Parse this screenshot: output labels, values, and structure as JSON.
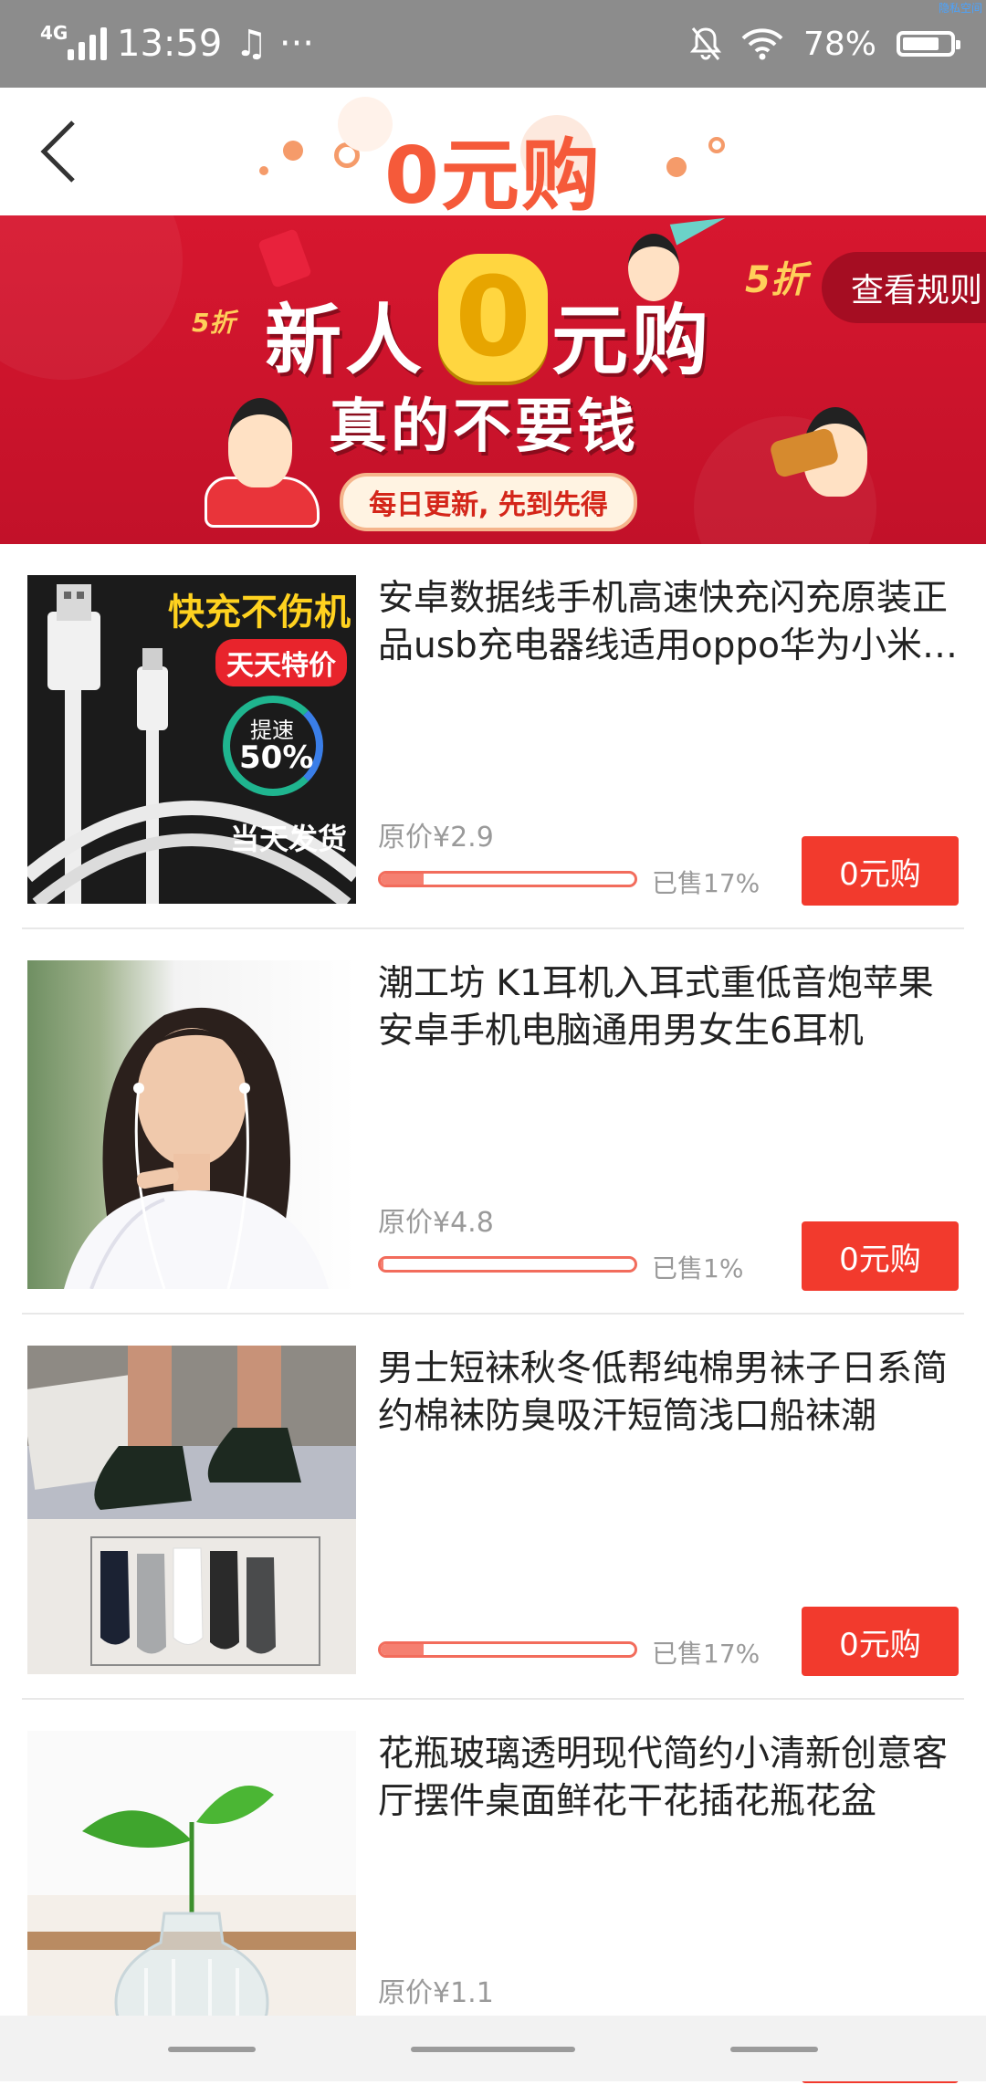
{
  "status_bar": {
    "network": "4G",
    "time": "13:59",
    "extra_icons": "♫ ···",
    "battery_text": "78%",
    "battery_level": 0.78,
    "corner_note": "隐私空间"
  },
  "header": {
    "title": "0元购",
    "back_icon": "chevron-left-icon"
  },
  "banner": {
    "headline_left": "新人",
    "headline_zero": "0",
    "headline_right": "元购",
    "subline": "真的不要钱",
    "pill_text": "每日更新, 先到先得",
    "rules_button": "查看规则",
    "tag_left": "5折",
    "tag_right": "5折",
    "accent": "#d7172f"
  },
  "products": [
    {
      "name": "安卓数据线手机高速快充闪充原装正品usb充电器线适用oppo华为小米vivo",
      "original_price": "原价¥2.9",
      "sold": "已售17%",
      "sold_fraction": 0.17,
      "buy_label": "0元购",
      "thumb": {
        "type": "cable",
        "headline": "快充不伤机",
        "badge": "天天特价",
        "speed_label": "提速",
        "speed_value": "50%",
        "ship": "当天发货"
      }
    },
    {
      "name": "潮工坊 K1耳机入耳式重低音炮苹果安卓手机电脑通用男女生6耳机",
      "original_price": "原价¥4.8",
      "sold": "已售1%",
      "sold_fraction": 0.01,
      "buy_label": "0元购",
      "thumb": {
        "type": "earphone-model"
      }
    },
    {
      "name": "男士短袜秋冬低帮纯棉男袜子日系简约棉袜防臭吸汗短筒浅口船袜潮",
      "original_price": "",
      "sold": "已售17%",
      "sold_fraction": 0.17,
      "buy_label": "0元购",
      "thumb": {
        "type": "socks"
      }
    },
    {
      "name": "花瓶玻璃透明现代简约小清新创意客厅摆件桌面鲜花干花插花瓶花盆",
      "original_price": "原价¥1.1",
      "sold": "",
      "sold_fraction": 0,
      "buy_label": "",
      "thumb": {
        "type": "vase"
      }
    }
  ],
  "colors": {
    "buy_button": "#f23a2d",
    "progress": "#f26c5c",
    "title": "#f55a3a"
  }
}
